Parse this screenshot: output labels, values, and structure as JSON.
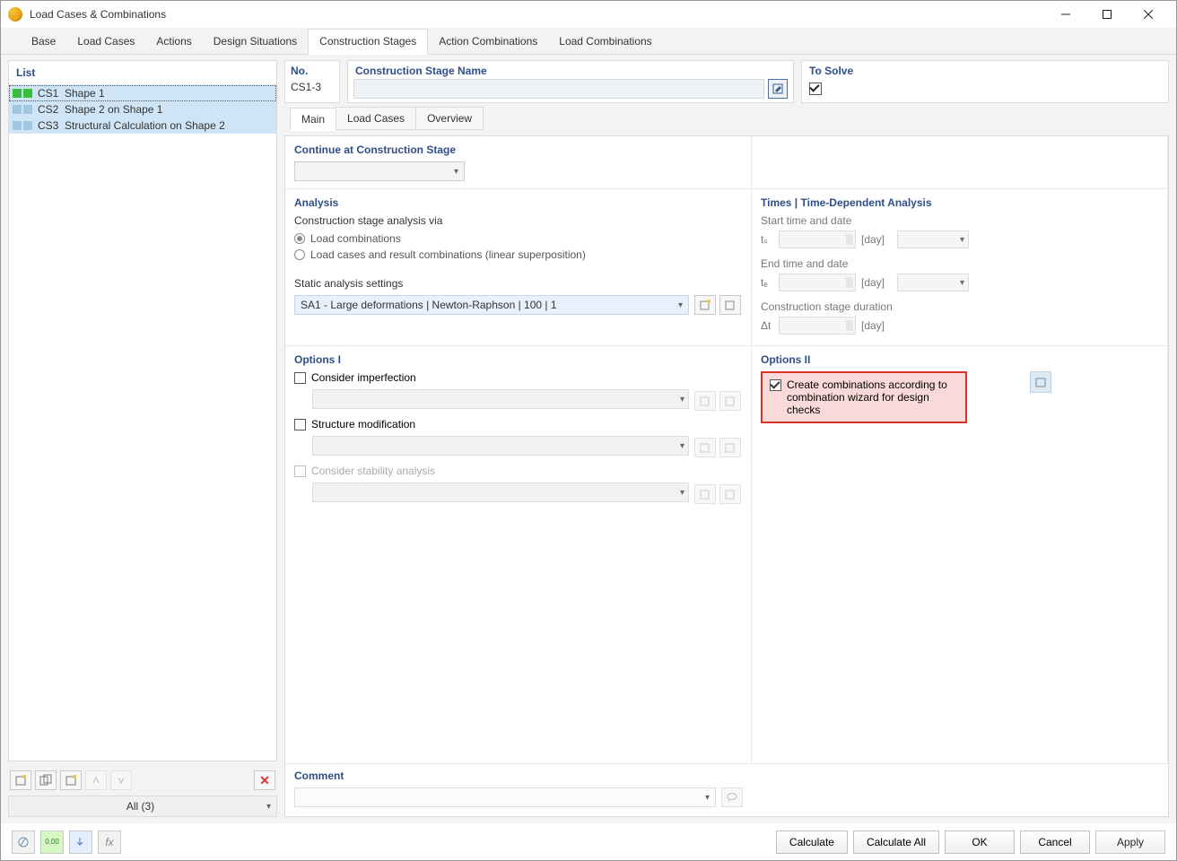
{
  "window": {
    "title": "Load Cases & Combinations"
  },
  "tabs": {
    "items": [
      "Base",
      "Load Cases",
      "Actions",
      "Design Situations",
      "Construction Stages",
      "Action Combinations",
      "Load Combinations"
    ],
    "active": 4
  },
  "list": {
    "header": "List",
    "rows": [
      {
        "id": "CS1",
        "name": "Shape 1",
        "primary": true,
        "markers": [
          "green",
          "green"
        ]
      },
      {
        "id": "CS2",
        "name": "Shape 2 on Shape 1",
        "primary": false,
        "markers": [
          "blue",
          "blue"
        ]
      },
      {
        "id": "CS3",
        "name": "Structural Calculation on Shape 2",
        "primary": false,
        "markers": [
          "blue",
          "blue"
        ]
      }
    ],
    "filter": "All (3)"
  },
  "stage": {
    "no_label": "No.",
    "no_value": "CS1-3",
    "name_label": "Construction Stage Name",
    "solve_label": "To Solve",
    "solve_checked": true
  },
  "inner_tabs": {
    "items": [
      "Main",
      "Load Cases",
      "Overview"
    ],
    "active": 0
  },
  "continue": {
    "title": "Continue at Construction Stage"
  },
  "analysis": {
    "title": "Analysis",
    "via_label": "Construction stage analysis via",
    "radio_a": "Load combinations",
    "radio_b": "Load cases and result combinations (linear superposition)",
    "static_label": "Static analysis settings",
    "static_value": "SA1 - Large deformations | Newton-Raphson | 100 | 1"
  },
  "times": {
    "title": "Times | Time-Dependent Analysis",
    "start_label": "Start time and date",
    "end_label": "End time and date",
    "dur_label": "Construction stage duration",
    "ts_sym": "tₛ",
    "te_sym": "tₑ",
    "dt_sym": "Δt",
    "unit": "[day]"
  },
  "options1": {
    "title": "Options I",
    "imperfection": "Consider imperfection",
    "structure": "Structure modification",
    "stability": "Consider stability analysis"
  },
  "options2": {
    "title": "Options II",
    "wizard": "Create combinations according to combination wizard for design checks"
  },
  "comment": {
    "title": "Comment"
  },
  "footer": {
    "calculate": "Calculate",
    "calculate_all": "Calculate All",
    "ok": "OK",
    "cancel": "Cancel",
    "apply": "Apply"
  }
}
